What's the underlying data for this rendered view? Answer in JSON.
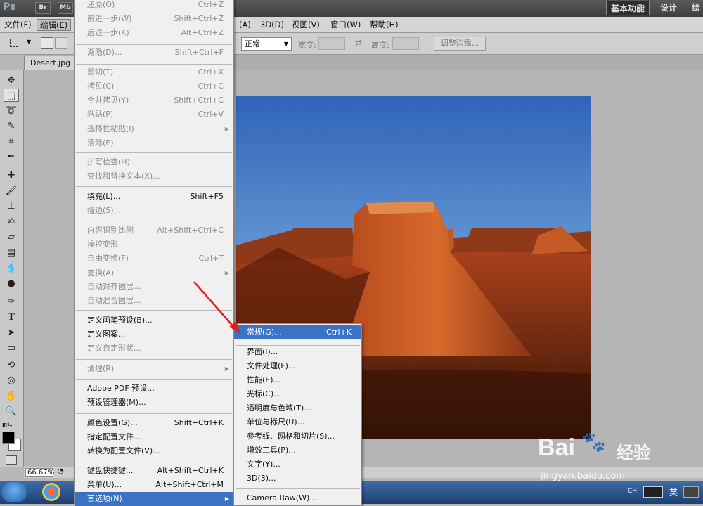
{
  "title_bar": {
    "app_logo": "Ps",
    "bridge_label": "Br",
    "mini_label": "Mb",
    "workspace_active": "基本功能",
    "workspace_design": "设计",
    "workspace_paint": "绘"
  },
  "menubar": {
    "file": "文件(F)",
    "edit": "编辑(E)",
    "analysis_partial": "(A)",
    "threed": "3D(D)",
    "view": "视图(V)",
    "window": "窗口(W)",
    "help": "帮助(H)"
  },
  "options_bar": {
    "style_value": "正常",
    "width_label": "宽度:",
    "height_label": "高度:",
    "refine_button": "调整边缘..."
  },
  "document": {
    "tab_label": "Desert.jpg @"
  },
  "status": {
    "zoom": "66.67%"
  },
  "edit_menu": {
    "items": [
      {
        "label": "还原(O)",
        "shortcut": "Ctrl+Z",
        "disabled": true
      },
      {
        "label": "前进一步(W)",
        "shortcut": "Shift+Ctrl+Z",
        "disabled": true
      },
      {
        "label": "后退一步(K)",
        "shortcut": "Alt+Ctrl+Z",
        "disabled": true
      },
      {
        "label": "渐隐(D)...",
        "shortcut": "Shift+Ctrl+F",
        "disabled": true
      },
      {
        "label": "剪切(T)",
        "shortcut": "Ctrl+X",
        "disabled": true
      },
      {
        "label": "拷贝(C)",
        "shortcut": "Ctrl+C",
        "disabled": true
      },
      {
        "label": "合并拷贝(Y)",
        "shortcut": "Shift+Ctrl+C",
        "disabled": true
      },
      {
        "label": "粘贴(P)",
        "shortcut": "Ctrl+V",
        "disabled": true
      },
      {
        "label": "选择性粘贴(I)",
        "shortcut": "",
        "disabled": true,
        "submenu": true
      },
      {
        "label": "清除(E)",
        "shortcut": "",
        "disabled": true
      },
      {
        "label": "拼写检查(H)...",
        "shortcut": "",
        "disabled": true
      },
      {
        "label": "查找和替换文本(X)...",
        "shortcut": "",
        "disabled": true
      },
      {
        "label": "填充(L)...",
        "shortcut": "Shift+F5",
        "disabled": false
      },
      {
        "label": "描边(S)...",
        "shortcut": "",
        "disabled": true
      },
      {
        "label": "内容识别比例",
        "shortcut": "Alt+Shift+Ctrl+C",
        "disabled": true
      },
      {
        "label": "操控变形",
        "shortcut": "",
        "disabled": true
      },
      {
        "label": "自由变换(F)",
        "shortcut": "Ctrl+T",
        "disabled": true
      },
      {
        "label": "变换(A)",
        "shortcut": "",
        "disabled": true,
        "submenu": true
      },
      {
        "label": "自动对齐图层...",
        "shortcut": "",
        "disabled": true
      },
      {
        "label": "自动混合图层...",
        "shortcut": "",
        "disabled": true
      },
      {
        "label": "定义画笔预设(B)...",
        "shortcut": "",
        "disabled": false
      },
      {
        "label": "定义图案...",
        "shortcut": "",
        "disabled": false
      },
      {
        "label": "定义自定形状...",
        "shortcut": "",
        "disabled": true
      },
      {
        "label": "清理(R)",
        "shortcut": "",
        "disabled": true,
        "submenu": true
      },
      {
        "label": "Adobe PDF 预设...",
        "shortcut": "",
        "disabled": false
      },
      {
        "label": "预设管理器(M)...",
        "shortcut": "",
        "disabled": false
      },
      {
        "label": "颜色设置(G)...",
        "shortcut": "Shift+Ctrl+K",
        "disabled": false
      },
      {
        "label": "指定配置文件...",
        "shortcut": "",
        "disabled": false
      },
      {
        "label": "转换为配置文件(V)...",
        "shortcut": "",
        "disabled": false
      },
      {
        "label": "键盘快捷键...",
        "shortcut": "Alt+Shift+Ctrl+K",
        "disabled": false
      },
      {
        "label": "菜单(U)...",
        "shortcut": "Alt+Shift+Ctrl+M",
        "disabled": false
      },
      {
        "label": "首选项(N)",
        "shortcut": "",
        "disabled": false,
        "submenu": true
      }
    ]
  },
  "prefs_menu": {
    "items": [
      {
        "label": "常规(G)...",
        "shortcut": "Ctrl+K"
      },
      {
        "label": "界面(I)...",
        "shortcut": ""
      },
      {
        "label": "文件处理(F)...",
        "shortcut": ""
      },
      {
        "label": "性能(E)...",
        "shortcut": ""
      },
      {
        "label": "光标(C)...",
        "shortcut": ""
      },
      {
        "label": "透明度与色域(T)...",
        "shortcut": ""
      },
      {
        "label": "单位与标尺(U)...",
        "shortcut": ""
      },
      {
        "label": "参考线、网格和切片(S)...",
        "shortcut": ""
      },
      {
        "label": "增效工具(P)...",
        "shortcut": ""
      },
      {
        "label": "文字(Y)...",
        "shortcut": ""
      },
      {
        "label": "3D(3)...",
        "shortcut": ""
      },
      {
        "label": "Camera Raw(W)...",
        "shortcut": ""
      }
    ]
  },
  "watermark": {
    "brand": "Bai",
    "brand_cn": "经验",
    "url": "jingyan.baidu.com"
  },
  "taskbar": {
    "lang": "CH",
    "ime": "英"
  },
  "colors": {
    "highlight": "#3a72c4",
    "annotation_arrow": "#e02020"
  }
}
